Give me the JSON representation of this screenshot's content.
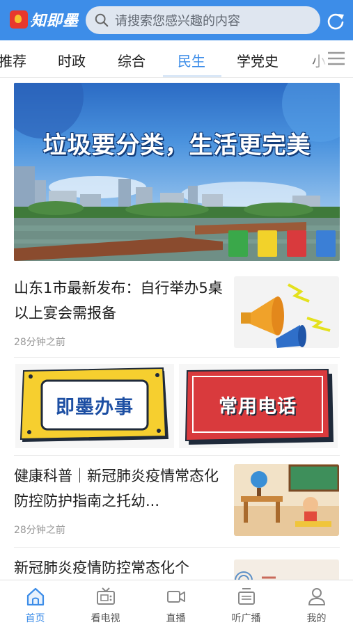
{
  "header": {
    "logo_text": "知即墨",
    "search_placeholder": "请搜索您感兴趣的内容"
  },
  "tabs": [
    {
      "label": "推荐"
    },
    {
      "label": "时政"
    },
    {
      "label": "综合"
    },
    {
      "label": "民生",
      "active": true
    },
    {
      "label": "学党史"
    },
    {
      "label": "小"
    }
  ],
  "banner": {
    "title": "垃圾要分类，生活更完美"
  },
  "news": [
    {
      "title": "山东1市最新发布：自行举办5桌以上宴会需报备",
      "time": "28分钟之前",
      "thumb": "megaphone-illustration"
    },
    {
      "title": "健康科普｜新冠肺炎疫情常态化防控防护指南之托幼...",
      "time": "28分钟之前",
      "thumb": "classroom-illustration"
    },
    {
      "title": "新冠肺炎疫情防控常态化个",
      "time": "",
      "thumb": "poster-thumbnail"
    }
  ],
  "services": [
    {
      "label": "即墨办事",
      "bg": "#f6cf2f",
      "fg": "#1d4fa3"
    },
    {
      "label": "常用电话",
      "bg": "#d93a3d",
      "fg": "#ffffff"
    }
  ],
  "bottom_nav": [
    {
      "label": "首页",
      "icon": "home-icon",
      "active": true
    },
    {
      "label": "看电视",
      "icon": "tv-icon"
    },
    {
      "label": "直播",
      "icon": "video-camera-icon"
    },
    {
      "label": "听广播",
      "icon": "radio-icon"
    },
    {
      "label": "我的",
      "icon": "user-icon"
    }
  ],
  "colors": {
    "accent": "#3d8de8",
    "text": "#1d1d1d",
    "muted": "#9a9a9a"
  }
}
